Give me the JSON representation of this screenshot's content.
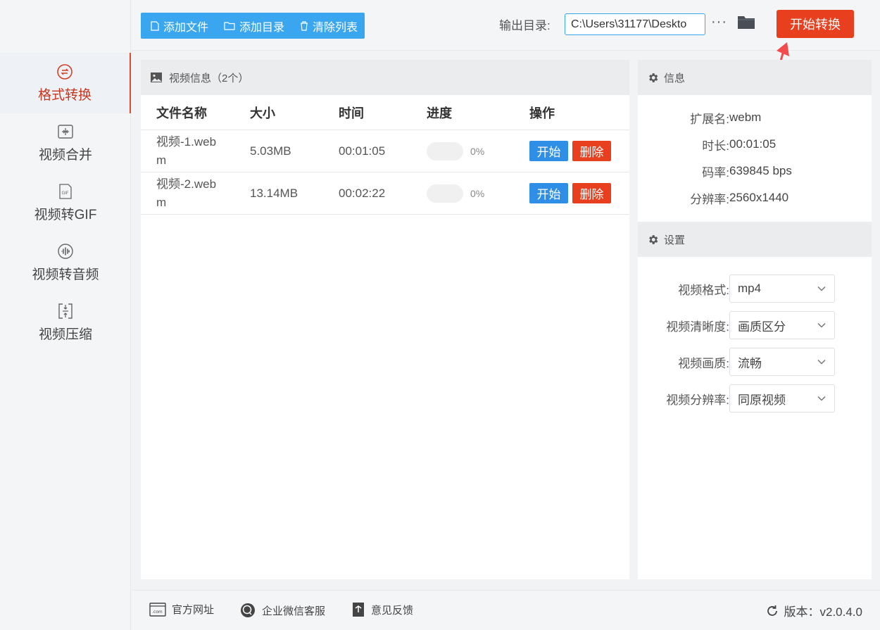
{
  "sidebar": {
    "items": [
      {
        "label": "格式转换",
        "icon": "convert-icon",
        "active": true
      },
      {
        "label": "视频合并",
        "icon": "merge-icon"
      },
      {
        "label": "视频转GIF",
        "icon": "gif-icon"
      },
      {
        "label": "视频转音频",
        "icon": "audio-icon"
      },
      {
        "label": "视频压缩",
        "icon": "compress-icon"
      }
    ]
  },
  "toolbar": {
    "add_file": "添加文件",
    "add_dir": "添加目录",
    "clear_list": "清除列表",
    "output_label": "输出目录:",
    "output_value": "C:\\Users\\31177\\Deskto",
    "more": "···",
    "start_convert": "开始转换"
  },
  "main": {
    "title": "视频信息（2个）",
    "columns": [
      "文件名称",
      "大小",
      "时间",
      "进度",
      "操作"
    ],
    "rows": [
      {
        "name": "视频-1.webm",
        "size": "5.03MB",
        "time": "00:01:05",
        "progress": 0,
        "progress_text": "0%",
        "start": "开始",
        "delete": "删除"
      },
      {
        "name": "视频-2.webm",
        "size": "13.14MB",
        "time": "00:02:22",
        "progress": 0,
        "progress_text": "0%",
        "start": "开始",
        "delete": "删除"
      }
    ]
  },
  "info": {
    "title": "信息",
    "rows": [
      {
        "k": "扩展名:",
        "v": "webm"
      },
      {
        "k": "时长:",
        "v": "00:01:05"
      },
      {
        "k": "码率:",
        "v": "639845 bps"
      },
      {
        "k": "分辨率:",
        "v": "2560x1440"
      }
    ]
  },
  "settings": {
    "title": "设置",
    "rows": [
      {
        "k": "视频格式:",
        "v": "mp4"
      },
      {
        "k": "视频清晰度:",
        "v": "画质区分"
      },
      {
        "k": "视频画质:",
        "v": "流畅"
      },
      {
        "k": "视频分辨率:",
        "v": "同原视频"
      }
    ]
  },
  "footer": {
    "website": "官方网址",
    "wechat": "企业微信客服",
    "feedback": "意见反馈",
    "version": "版本：v2.0.4.0"
  },
  "colors": {
    "accent": "#3aa6ef",
    "danger": "#e8401f",
    "active_text": "#c7361d"
  }
}
